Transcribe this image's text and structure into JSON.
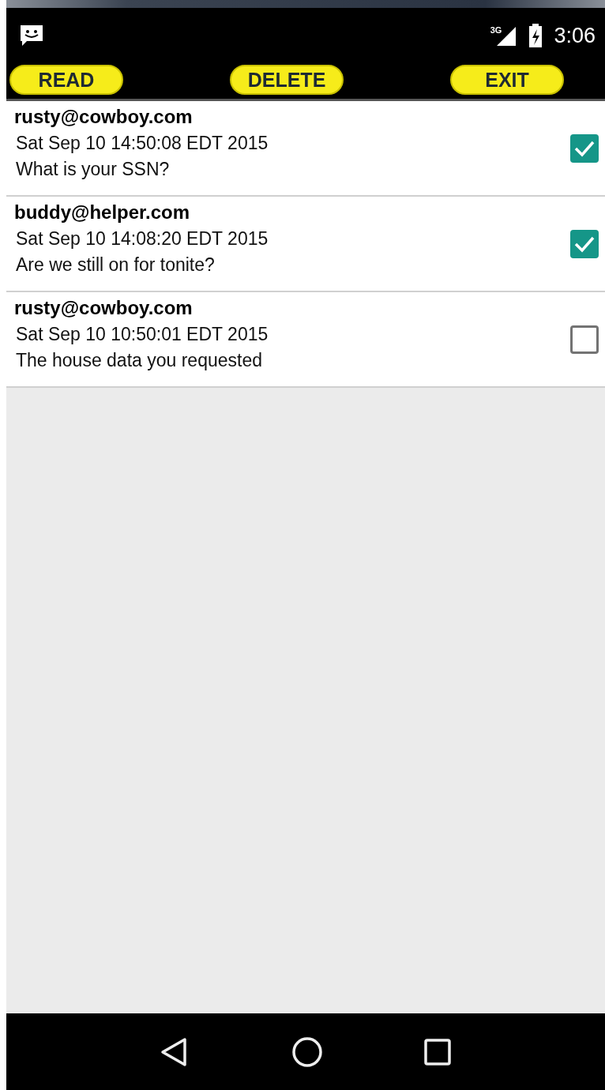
{
  "status_bar": {
    "network": "3G",
    "time": "3:06"
  },
  "toolbar": {
    "buttons": [
      "READ",
      "DELETE",
      "EXIT"
    ]
  },
  "messages": [
    {
      "sender": "rusty@cowboy.com",
      "date": "Sat Sep 10 14:50:08 EDT 2015",
      "subject": "What is your SSN?",
      "checked": true
    },
    {
      "sender": "buddy@helper.com",
      "date": "Sat Sep 10 14:08:20 EDT 2015",
      "subject": "Are we still on for tonite?",
      "checked": true
    },
    {
      "sender": "rusty@cowboy.com",
      "date": "Sat Sep 10 10:50:01 EDT 2015",
      "subject": "The house data you requested",
      "checked": false
    }
  ]
}
